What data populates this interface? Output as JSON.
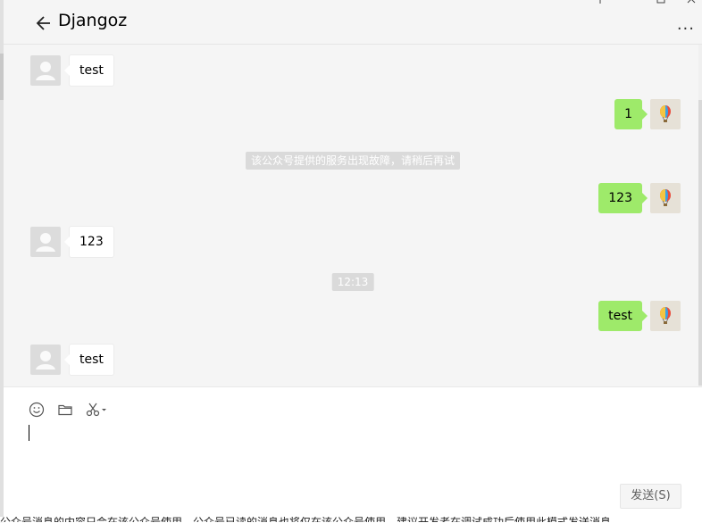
{
  "window": {
    "title": "Djangoz",
    "controls": [
      "pin",
      "minimize",
      "maximize",
      "close"
    ],
    "more_label": "..."
  },
  "messages": [
    {
      "side": "left",
      "text": "test"
    },
    {
      "side": "right",
      "text": "1"
    },
    {
      "type": "system",
      "text": "该公众号提供的服务出现故障，请稍后再试"
    },
    {
      "side": "right",
      "text": "123"
    },
    {
      "side": "left",
      "text": "123"
    },
    {
      "type": "time",
      "text": "12:13"
    },
    {
      "side": "right",
      "text": "test"
    },
    {
      "side": "left",
      "text": "test"
    }
  ],
  "composer": {
    "value": "",
    "send_label": "发送(S)",
    "tools": [
      "emoji-icon",
      "folder-icon",
      "scissors-icon"
    ]
  },
  "status_text": "公众号消息的内容只会在该公众号使用，公众号已读的消息也将仅在该公众号使用，建议开发者在调试成功后使用此模式发送消息。"
}
